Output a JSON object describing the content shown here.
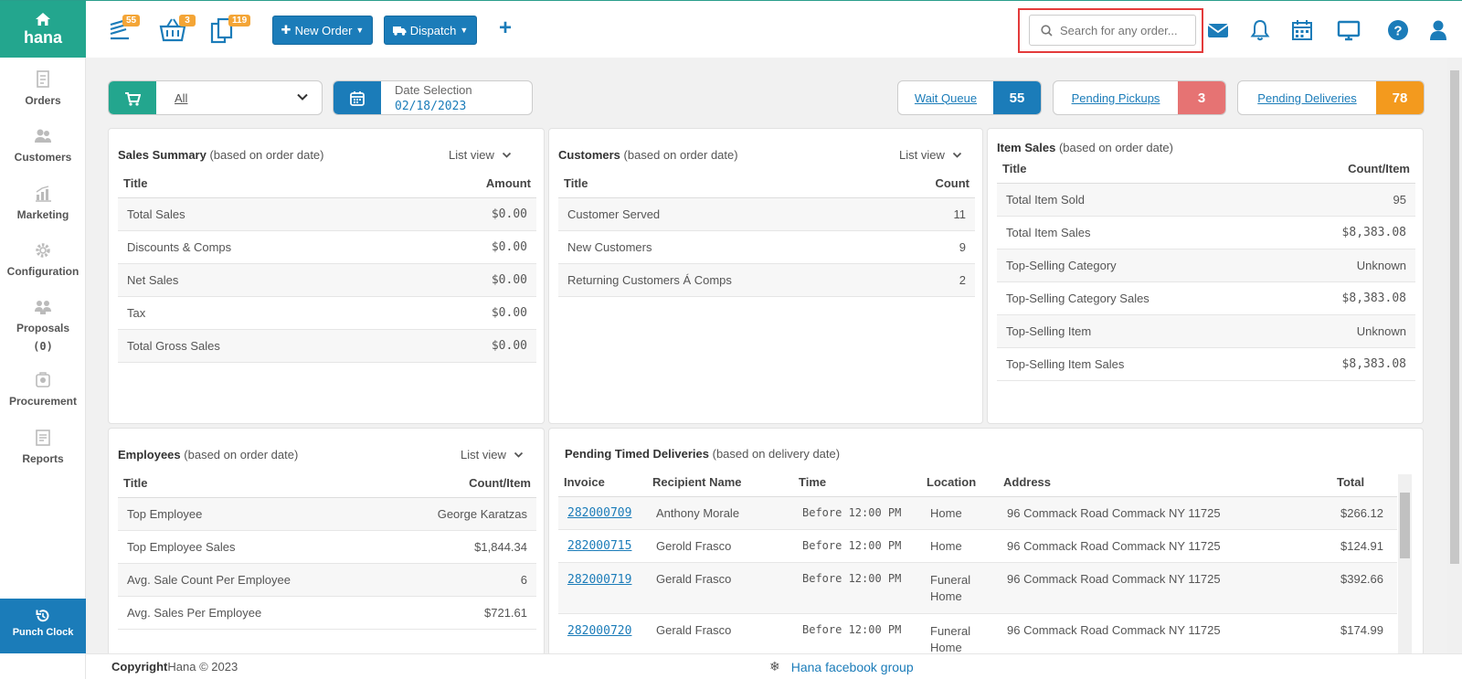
{
  "app": {
    "logo_text": "hana"
  },
  "toolbar": {
    "badges": {
      "orders": "55",
      "basket": "3",
      "copies": "119"
    },
    "new_order_label": "New Order",
    "dispatch_label": "Dispatch",
    "plus_label": "+"
  },
  "search": {
    "placeholder": "Search for any order..."
  },
  "sidebar": {
    "items": [
      {
        "label": "Orders",
        "icon": "orders-icon"
      },
      {
        "label": "Customers",
        "icon": "customers-icon"
      },
      {
        "label": "Marketing",
        "icon": "marketing-icon"
      },
      {
        "label": "Configuration",
        "icon": "gear-icon"
      },
      {
        "label": "Proposals",
        "icon": "proposals-icon"
      },
      {
        "label": "(0)",
        "icon": ""
      },
      {
        "label": "Procurement",
        "icon": "procurement-icon"
      },
      {
        "label": "Reports",
        "icon": "reports-icon"
      }
    ],
    "punch_clock": "Punch Clock"
  },
  "filters": {
    "store": "All",
    "date_label": "Date Selection",
    "date_value": "02/18/2023"
  },
  "queues": {
    "wait_label": "Wait Queue",
    "wait_count": "55",
    "pickups_label": "Pending Pickups",
    "pickups_count": "3",
    "deliveries_label": "Pending Deliveries",
    "deliveries_count": "78"
  },
  "colors": {
    "brand": "#23a68e",
    "primary": "#1b7cb9",
    "danger": "#e67373",
    "warning": "#f39a1e",
    "badge": "#f4a536"
  },
  "sales_summary": {
    "title": "Sales Summary",
    "note": "(based on order date)",
    "view": "List view",
    "col1": "Title",
    "col2": "Amount",
    "rows": [
      {
        "title": "Total Sales",
        "value": "$0.00"
      },
      {
        "title": "Discounts & Comps",
        "value": "$0.00"
      },
      {
        "title": "Net Sales",
        "value": "$0.00"
      },
      {
        "title": "Tax",
        "value": "$0.00"
      },
      {
        "title": "Total Gross Sales",
        "value": "$0.00"
      }
    ]
  },
  "customers": {
    "title": "Customers",
    "note": "(based on order date)",
    "view": "List view",
    "col1": "Title",
    "col2": "Count",
    "rows": [
      {
        "title": "Customer Served",
        "value": "11"
      },
      {
        "title": "New Customers",
        "value": "9"
      },
      {
        "title": "Returning Customers Á Comps",
        "value": "2"
      }
    ]
  },
  "item_sales": {
    "title": "Item Sales",
    "note": "(based on order date)",
    "col1": "Title",
    "col2": "Count/Item",
    "rows": [
      {
        "title": "Total Item Sold",
        "value": "95"
      },
      {
        "title": "Total Item Sales",
        "value": "$8,383.08"
      },
      {
        "title": "Top-Selling Category",
        "value": "Unknown"
      },
      {
        "title": "Top-Selling Category Sales",
        "value": "$8,383.08"
      },
      {
        "title": "Top-Selling Item",
        "value": "Unknown"
      },
      {
        "title": "Top-Selling Item Sales",
        "value": "$8,383.08"
      }
    ]
  },
  "employees": {
    "title": "Employees",
    "note": "(based on order date)",
    "view": "List view",
    "col1": "Title",
    "col2": "Count/Item",
    "rows": [
      {
        "title": "Top Employee",
        "value": "George Karatzas"
      },
      {
        "title": "Top Employee Sales",
        "value": "$1,844.34"
      },
      {
        "title": "Avg. Sale Count Per Employee",
        "value": "6"
      },
      {
        "title": "Avg. Sales Per Employee",
        "value": "$721.61"
      }
    ]
  },
  "deliveries": {
    "title": "Pending Timed Deliveries",
    "note": "(based on delivery date)",
    "columns": [
      "Invoice",
      "Recipient Name",
      "Time",
      "Location",
      "Address",
      "Total"
    ],
    "rows": [
      {
        "invoice": "282000709",
        "name": "Anthony Morale",
        "time": "Before 12:00 PM",
        "location": "Home",
        "address": "96 Commack Road Commack NY 11725",
        "total": "$266.12"
      },
      {
        "invoice": "282000715",
        "name": "Gerold Frasco",
        "time": "Before 12:00 PM",
        "location": "Home",
        "address": "96 Commack Road Commack NY 11725",
        "total": "$124.91"
      },
      {
        "invoice": "282000719",
        "name": "Gerald Frasco",
        "time": "Before 12:00 PM",
        "location": "Funeral Home",
        "address": "96 Commack Road Commack NY 11725",
        "total": "$392.66"
      },
      {
        "invoice": "282000720",
        "name": "Gerald Frasco",
        "time": "Before 12:00 PM",
        "location": "Funeral Home",
        "address": "96 Commack Road Commack NY 11725",
        "total": "$174.99"
      }
    ]
  },
  "footer": {
    "copyright_label": "Copyright",
    "copyright_text": "Hana © 2023",
    "fb_link": "Hana facebook group"
  }
}
